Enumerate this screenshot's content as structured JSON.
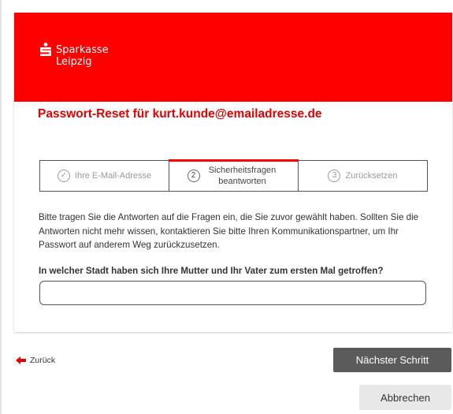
{
  "brand": {
    "name_line1": "Sparkasse",
    "name_line2": "Leipzig",
    "color": "#ff0000"
  },
  "page": {
    "title": "Passwort-Reset für kurt.kunde@emailadresse.de"
  },
  "steps": [
    {
      "marker": "✓",
      "label": "Ihre E-Mail-Adresse",
      "state": "done"
    },
    {
      "marker": "2",
      "label": "Sicherheitsfragen beantworten",
      "state": "active"
    },
    {
      "marker": "3",
      "label": "Zurücksetzen",
      "state": "upcoming"
    }
  ],
  "intro_text": "Bitte tragen Sie die Antworten auf die Fragen ein, die Sie zuvor gewählt haben. Sollten Sie die Antworten nicht mehr wissen, kontaktieren Sie bitte Ihren Kommunikationspartner, um Ihr Passwort auf anderem Weg zurückzusetzen.",
  "question": {
    "label": "In welcher Stadt haben sich Ihre Mutter und Ihr Vater zum ersten Mal getroffen?",
    "value": ""
  },
  "nav": {
    "back_label": "Zurück",
    "next_label": "Nächster Schritt",
    "cancel_label": "Abbrechen"
  },
  "icons": {
    "logo": "sparkasse-logo-icon",
    "back": "arrow-left-icon"
  }
}
